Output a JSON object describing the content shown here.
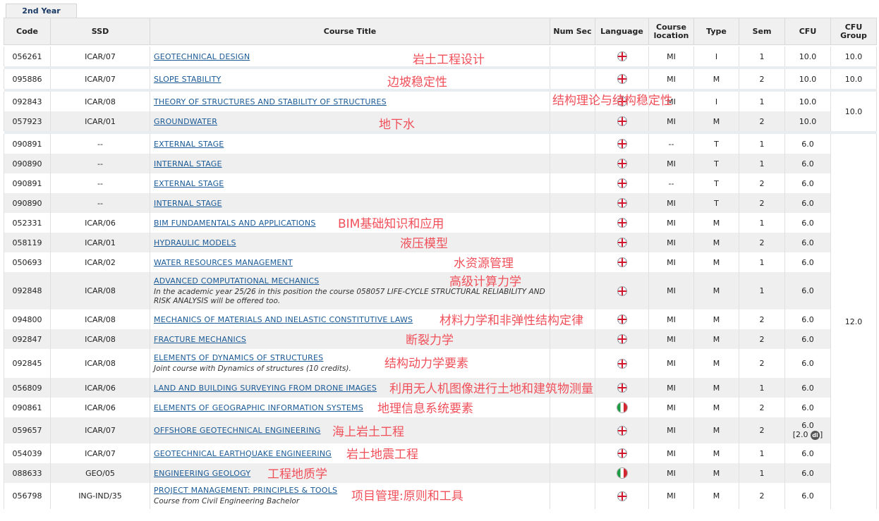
{
  "tab_label": "2nd Year",
  "headers": {
    "code": "Code",
    "ssd": "SSD",
    "title": "Course Title",
    "numsec": "Num Sec",
    "language": "Language",
    "location": "Course location",
    "type": "Type",
    "sem": "Sem",
    "cfu": "CFU",
    "cfu_group": "CFU Group"
  },
  "rows": [
    {
      "code": "056261",
      "ssd": "ICAR/07",
      "title": "GEOTECHNICAL DESIGN",
      "zh": "岩土工程设计",
      "lang": "english-flag-icon",
      "loc": "MI",
      "type": "I",
      "sem": "1",
      "cfu": "10.0",
      "group": "10.0"
    },
    {
      "code": "095886",
      "ssd": "ICAR/07",
      "title": "SLOPE STABILITY",
      "zh": "边坡稳定性",
      "lang": "english-flag-icon",
      "loc": "MI",
      "type": "M",
      "sem": "2",
      "cfu": "10.0",
      "group": "10.0"
    },
    {
      "code": "092843",
      "ssd": "ICAR/08",
      "title": "THEORY OF STRUCTURES AND STABILITY OF STRUCTURES",
      "zh": "结构理论与结构稳定性",
      "lang": "english-flag-icon",
      "loc": "MI",
      "type": "I",
      "sem": "1",
      "cfu": "10.0",
      "group": "10.0"
    },
    {
      "code": "057923",
      "ssd": "ICAR/01",
      "title": "GROUNDWATER",
      "zh": "地下水",
      "lang": "english-flag-icon",
      "loc": "MI",
      "type": "M",
      "sem": "2",
      "cfu": "10.0"
    },
    {
      "code": "090891",
      "ssd": "--",
      "title": "EXTERNAL STAGE",
      "lang": "english-flag-icon",
      "loc": "--",
      "type": "T",
      "sem": "1",
      "cfu": "6.0",
      "group": "12.0"
    },
    {
      "code": "090890",
      "ssd": "--",
      "title": "INTERNAL STAGE",
      "lang": "english-flag-icon",
      "loc": "MI",
      "type": "T",
      "sem": "1",
      "cfu": "6.0"
    },
    {
      "code": "090891",
      "ssd": "--",
      "title": "EXTERNAL STAGE",
      "lang": "english-flag-icon",
      "loc": "--",
      "type": "T",
      "sem": "2",
      "cfu": "6.0"
    },
    {
      "code": "090890",
      "ssd": "--",
      "title": "INTERNAL STAGE",
      "lang": "english-flag-icon",
      "loc": "MI",
      "type": "T",
      "sem": "2",
      "cfu": "6.0"
    },
    {
      "code": "052331",
      "ssd": "ICAR/06",
      "title": "BIM FUNDAMENTALS AND APPLICATIONS",
      "zh": "BIM基础知识和应用",
      "lang": "english-flag-icon",
      "loc": "MI",
      "type": "M",
      "sem": "1",
      "cfu": "6.0"
    },
    {
      "code": "058119",
      "ssd": "ICAR/01",
      "title": "HYDRAULIC MODELS",
      "zh": "液压模型",
      "lang": "english-flag-icon",
      "loc": "MI",
      "type": "M",
      "sem": "2",
      "cfu": "6.0"
    },
    {
      "code": "050693",
      "ssd": "ICAR/02",
      "title": "WATER RESOURCES MANAGEMENT",
      "zh": "水资源管理",
      "lang": "english-flag-icon",
      "loc": "MI",
      "type": "M",
      "sem": "1",
      "cfu": "6.0"
    },
    {
      "code": "092848",
      "ssd": "ICAR/08",
      "title": "ADVANCED COMPUTATIONAL MECHANICS",
      "zh": "高级计算力学",
      "note": "In the academic year 25/26 in this position the course 058057 LIFE-CYCLE STRUCTURAL RELIABILITY AND RISK ANALYSIS will be offered too.",
      "lang": "english-flag-icon",
      "loc": "MI",
      "type": "M",
      "sem": "1",
      "cfu": "6.0"
    },
    {
      "code": "094800",
      "ssd": "ICAR/08",
      "title": "MECHANICS OF MATERIALS AND INELASTIC CONSTITUTIVE LAWS",
      "zh": "材料力学和非弹性结构定律",
      "lang": "english-flag-icon",
      "loc": "MI",
      "type": "M",
      "sem": "2",
      "cfu": "6.0"
    },
    {
      "code": "092847",
      "ssd": "ICAR/08",
      "title": "FRACTURE MECHANICS",
      "zh": "断裂力学",
      "lang": "english-flag-icon",
      "loc": "MI",
      "type": "M",
      "sem": "2",
      "cfu": "6.0"
    },
    {
      "code": "092845",
      "ssd": "ICAR/08",
      "title": "ELEMENTS OF DYNAMICS OF STRUCTURES",
      "zh": "结构动力学要素",
      "note": "Joint course with Dynamics of structures (10 credits).",
      "lang": "english-flag-icon",
      "loc": "MI",
      "type": "M",
      "sem": "2",
      "cfu": "6.0"
    },
    {
      "code": "056809",
      "ssd": "ICAR/06",
      "title": "LAND AND BUILDING SURVEYING FROM DRONE IMAGES",
      "zh": "利用无人机图像进行土地和建筑物测量",
      "lang": "english-flag-icon",
      "loc": "MI",
      "type": "M",
      "sem": "1",
      "cfu": "6.0"
    },
    {
      "code": "090861",
      "ssd": "ICAR/06",
      "title": "ELEMENTS OF GEOGRAPHIC INFORMATION SYSTEMS",
      "zh": "地理信息系统要素",
      "lang": "italian-flag-icon",
      "loc": "MI",
      "type": "M",
      "sem": "2",
      "cfu": "6.0"
    },
    {
      "code": "059657",
      "ssd": "ICAR/07",
      "title": "OFFSHORE GEOTECHNICAL ENGINEERING",
      "zh": "海上岩土工程",
      "lang": "english-flag-icon",
      "loc": "MI",
      "type": "M",
      "sem": "2",
      "cfu": "6.0",
      "cfu_extra": "[2.0",
      "cfu_badge": "di",
      "cfu_close": "]"
    },
    {
      "code": "054039",
      "ssd": "ICAR/07",
      "title": "GEOTECHNICAL EARTHQUAKE ENGINEERING",
      "zh": "岩土地震工程",
      "lang": "english-flag-icon",
      "loc": "MI",
      "type": "M",
      "sem": "1",
      "cfu": "6.0"
    },
    {
      "code": "088633",
      "ssd": "GEO/05",
      "title": "ENGINEERING GEOLOGY",
      "zh": "工程地质学",
      "lang": "italian-flag-icon",
      "loc": "MI",
      "type": "M",
      "sem": "1",
      "cfu": "6.0"
    },
    {
      "code": "056798",
      "ssd": "ING-IND/35",
      "title": "PROJECT MANAGEMENT: PRINCIPLES & TOOLS",
      "zh": "项目管理:原则和工具",
      "note": "Course from Civil Engineering Bachelor",
      "lang": "english-flag-icon",
      "loc": "MI",
      "type": "M",
      "sem": "2",
      "cfu": "6.0"
    }
  ]
}
